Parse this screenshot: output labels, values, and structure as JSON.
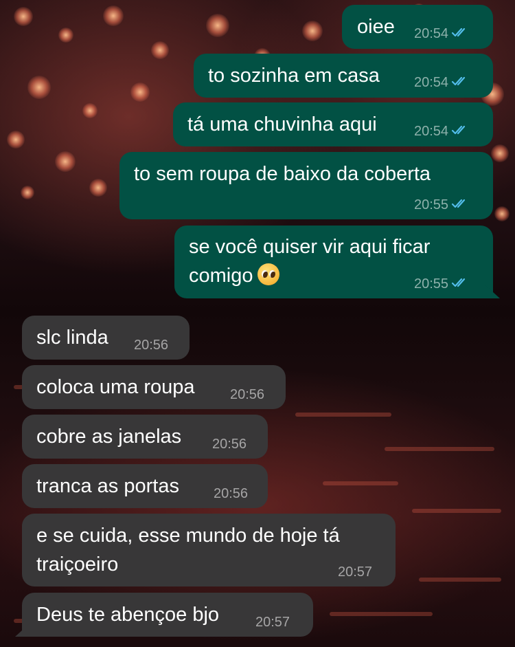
{
  "conversation": {
    "messages": [
      {
        "direction": "outgoing",
        "text": "oiee",
        "time": "20:54",
        "status": "read"
      },
      {
        "direction": "outgoing",
        "text": "to sozinha em casa",
        "time": "20:54",
        "status": "read"
      },
      {
        "direction": "outgoing",
        "text": "tá uma chuvinha aqui",
        "time": "20:54",
        "status": "read"
      },
      {
        "direction": "outgoing",
        "text": "to sem roupa de baixo da coberta",
        "time": "20:55",
        "status": "read"
      },
      {
        "direction": "outgoing",
        "text": "se você quiser vir aqui ficar\ncomigo",
        "emoji": "pleading-face-emoji",
        "time": "20:55",
        "status": "read"
      },
      {
        "direction": "incoming",
        "text": "slc linda",
        "time": "20:56"
      },
      {
        "direction": "incoming",
        "text": "coloca uma roupa",
        "time": "20:56"
      },
      {
        "direction": "incoming",
        "text": "cobre as janelas",
        "time": "20:56"
      },
      {
        "direction": "incoming",
        "text": "tranca as portas",
        "time": "20:56"
      },
      {
        "direction": "incoming",
        "text": "e se cuida, esse mundo de hoje tá\ntraiçoeiro",
        "time": "20:57"
      },
      {
        "direction": "incoming",
        "text": "Deus te abençoe bjo",
        "time": "20:57"
      }
    ]
  },
  "colors": {
    "outgoing_bubble": "#025144",
    "incoming_bubble": "#383738",
    "read_ticks": "#53bdeb",
    "timestamp": "rgba(255,255,255,0.55)"
  },
  "icons": {
    "read_receipt": "double-check-icon"
  }
}
